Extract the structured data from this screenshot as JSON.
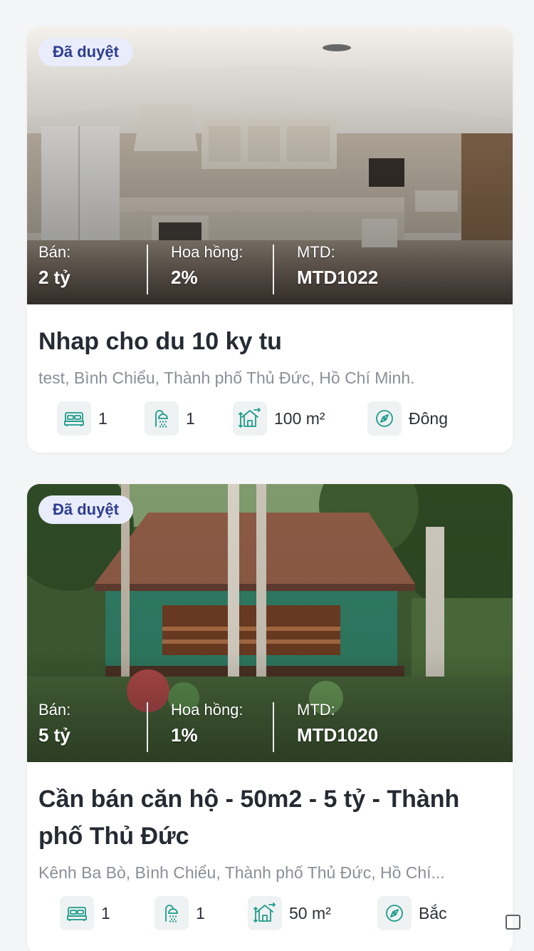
{
  "listings": [
    {
      "badge": "Đã duyệt",
      "sale_label": "Bán:",
      "sale_value": "2 tỷ",
      "commission_label": "Hoa hồng:",
      "commission_value": "2%",
      "code_label": "MTD:",
      "code_value": "MTD1022",
      "title": "Nhap cho du 10 ky tu",
      "address": "test, Bình Chiểu, Thành phố Thủ Đức, Hồ Chí Minh.",
      "bedrooms": "1",
      "bathrooms": "1",
      "area": "100 m²",
      "direction": "Đông",
      "photo": "kitchen-panorama"
    },
    {
      "badge": "Đã duyệt",
      "sale_label": "Bán:",
      "sale_value": "5 tỷ",
      "commission_label": "Hoa hồng:",
      "commission_value": "1%",
      "code_label": "MTD:",
      "code_value": "MTD1020",
      "title": "Cần bán căn hộ - 50m2 - 5 tỷ - Thành phố Thủ Đức",
      "address": "Kênh Ba Bò, Bình Chiểu, Thành phố Thủ Đức, Hồ Chí...",
      "bedrooms": "1",
      "bathrooms": "1",
      "area": "50 m²",
      "direction": "Bắc",
      "photo": "stilt-house-garden"
    }
  ],
  "icons": {
    "bed": "bed-icon",
    "shower": "shower-icon",
    "area": "area-icon",
    "compass": "compass-icon"
  },
  "colors": {
    "accent": "#1f9c8a",
    "badge_bg": "#e8ecfb",
    "badge_text": "#2f3e8f"
  }
}
